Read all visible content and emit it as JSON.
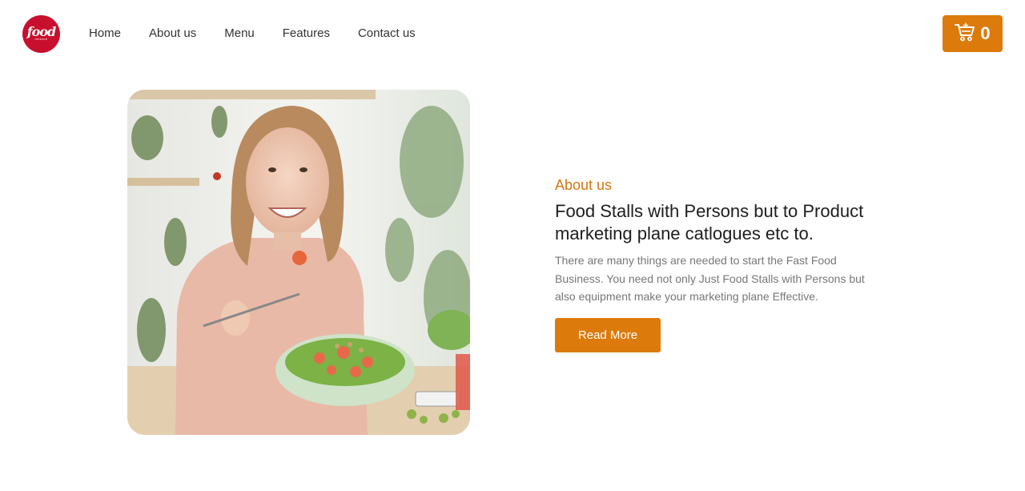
{
  "brand": {
    "logo_word": "food",
    "logo_sub": "network",
    "color": "#c8102e"
  },
  "nav": {
    "items": [
      {
        "label": "Home"
      },
      {
        "label": "About us"
      },
      {
        "label": "Menu"
      },
      {
        "label": "Features"
      },
      {
        "label": "Contact us"
      }
    ]
  },
  "cart": {
    "icon": "cart-icon",
    "count": "0",
    "color": "#dc7a0b"
  },
  "about": {
    "kicker": "About us",
    "headline_line1": "Food Stalls with Persons but to Product",
    "headline_line2": "marketing plane catlogues etc to.",
    "description": "There are many things are needed to start the Fast Food Business. You need not only Just Food Stalls with Persons but also equipment make your marketing plane Effective.",
    "button_label": "Read More",
    "accent": "#dc7a0b"
  }
}
